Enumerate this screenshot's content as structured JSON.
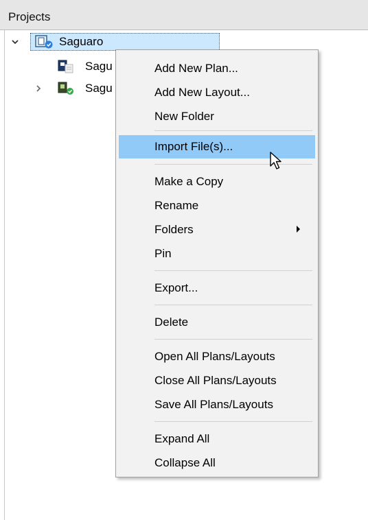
{
  "panel": {
    "title": "Projects"
  },
  "tree": {
    "root": {
      "label": "Saguaro",
      "icon": "project-icon",
      "expanded": true
    },
    "children": [
      {
        "label": "Sagu",
        "icon": "plan-icon"
      },
      {
        "label": "Sagu",
        "icon": "layout-icon",
        "expandable": true
      }
    ]
  },
  "context_menu": {
    "items": [
      "Add New Plan...",
      "Add New Layout...",
      "New Folder",
      "Import File(s)...",
      "Make a Copy",
      "Rename",
      "Folders",
      "Pin",
      "Export...",
      "Delete",
      "Open All Plans/Layouts",
      "Close All Plans/Layouts",
      "Save All Plans/Layouts",
      "Expand All",
      "Collapse All"
    ],
    "highlighted": "Import File(s)..."
  },
  "colors": {
    "selection": "#cce8ff",
    "hover": "#91c9f7",
    "menu_bg": "#f2f2f2",
    "header_bg": "#e6e6e6"
  }
}
